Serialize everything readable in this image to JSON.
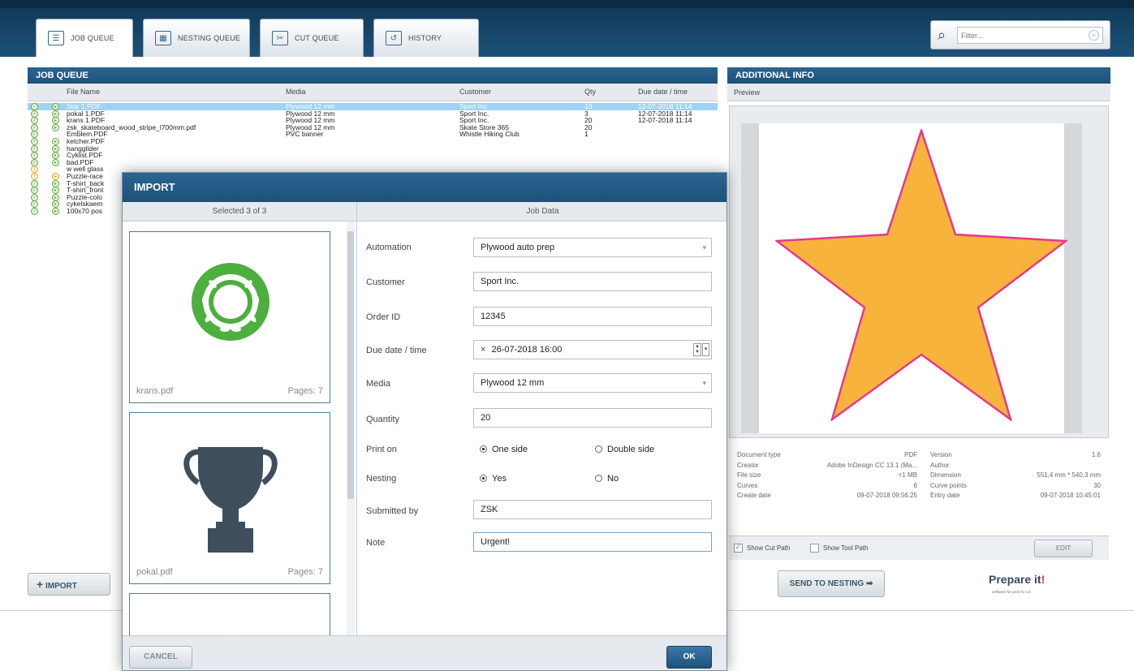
{
  "tabs": [
    {
      "label": "JOB QUEUE",
      "icon": "list-icon",
      "active": true
    },
    {
      "label": "NESTING QUEUE",
      "icon": "nesting-icon",
      "active": false
    },
    {
      "label": "CUT QUEUE",
      "icon": "scissors-icon",
      "active": false
    },
    {
      "label": "HISTORY",
      "icon": "history-icon",
      "active": false
    }
  ],
  "filter": {
    "placeholder": "Filter..."
  },
  "job_queue": {
    "title": "JOB QUEUE",
    "columns": [
      "File Name",
      "Media",
      "Customer",
      "Qty",
      "Due date / time"
    ],
    "rows": [
      {
        "status": "ok",
        "prep": "ok",
        "file": "Star 1.PDF",
        "media": "Plywood 12 mm",
        "customer": "Sport Inc.",
        "qty": "10",
        "due": "12-07-2018 11:14",
        "selected": true
      },
      {
        "status": "ok",
        "prep": "ok",
        "file": "pokal 1.PDF",
        "media": "Plywood 12 mm",
        "customer": "Sport Inc.",
        "qty": "3",
        "due": "12-07-2018 11:14"
      },
      {
        "status": "ok",
        "prep": "ok",
        "file": "krans 1.PDF",
        "media": "Plywood 12 mm",
        "customer": "Sport Inc.",
        "qty": "20",
        "due": "12-07-2018 11:14"
      },
      {
        "status": "ok",
        "prep": "ok",
        "file": "zsk_skateboard_wood_stripe_l700mm.pdf",
        "media": "Plywood 12 mm",
        "customer": "Skate Store 365",
        "qty": "20",
        "due": ""
      },
      {
        "status": "ok",
        "prep": "",
        "file": "Emblem.PDF",
        "media": "PVC banner",
        "customer": "Whistle Hiking Club",
        "qty": "1",
        "due": ""
      },
      {
        "status": "ok",
        "prep": "ok",
        "file": "ketcher.PDF",
        "media": "",
        "customer": "",
        "qty": "",
        "due": ""
      },
      {
        "status": "ok",
        "prep": "ok",
        "file": "hangglider",
        "media": "",
        "customer": "",
        "qty": "",
        "due": ""
      },
      {
        "status": "ok",
        "prep": "ok",
        "file": "Cyklist.PDF",
        "media": "",
        "customer": "",
        "qty": "",
        "due": ""
      },
      {
        "status": "ok",
        "prep": "ok",
        "file": "bad.PDF",
        "media": "",
        "customer": "",
        "qty": "",
        "due": ""
      },
      {
        "status": "warn",
        "prep": "",
        "file": "w well glass",
        "media": "",
        "customer": "",
        "qty": "",
        "due": ""
      },
      {
        "status": "warn",
        "prep": "warn",
        "file": "Puzzle-race",
        "media": "",
        "customer": "",
        "qty": "",
        "due": ""
      },
      {
        "status": "ok",
        "prep": "ok",
        "file": "T-shirt_back",
        "media": "",
        "customer": "",
        "qty": "",
        "due": ""
      },
      {
        "status": "ok",
        "prep": "ok",
        "file": "T-shirt_front",
        "media": "",
        "customer": "",
        "qty": "",
        "due": ""
      },
      {
        "status": "ok",
        "prep": "ok",
        "file": "Puzzle-colo",
        "media": "",
        "customer": "",
        "qty": "",
        "due": ""
      },
      {
        "status": "ok",
        "prep": "ok",
        "file": "cykelskaem",
        "media": "",
        "customer": "",
        "qty": "",
        "due": ""
      },
      {
        "status": "ok",
        "prep": "ok",
        "file": "100x70 pos",
        "media": "",
        "customer": "",
        "qty": "",
        "due": ""
      }
    ],
    "import_label": "IMPORT"
  },
  "additional_info": {
    "title": "ADDITIONAL INFO",
    "preview_label": "Preview",
    "meta_left": [
      {
        "k": "Document type",
        "v": "PDF"
      },
      {
        "k": "Creator",
        "v": "Adobe InDesign CC 13.1 (Ma..."
      },
      {
        "k": "File size",
        "v": "<1 MB"
      },
      {
        "k": "Curves",
        "v": "6"
      },
      {
        "k": "Create date",
        "v": "09-07-2018 09:56:25"
      }
    ],
    "meta_right": [
      {
        "k": "Version",
        "v": "1.6"
      },
      {
        "k": "Author",
        "v": ""
      },
      {
        "k": "Dimension",
        "v": "551,4 mm * 540,3 mm"
      },
      {
        "k": "Curve points",
        "v": "30"
      },
      {
        "k": "Entry date",
        "v": "09-07-2018 10:45:01"
      }
    ],
    "show_cut_path": "Show Cut Path",
    "show_tool_path": "Show Tool Path",
    "edit_label": "EDIT",
    "send_label": "SEND TO NESTING",
    "logo_text": "Prepare it",
    "logo_tagline": "software for print to cut",
    "colors": {
      "star_fill": "#f7b33c",
      "star_stroke": "#e6398b"
    }
  },
  "import_dialog": {
    "title": "IMPORT",
    "selected_label": "Selected 3 of 3",
    "job_data_label": "Job Data",
    "thumbnails": [
      {
        "name": "krans.pdf",
        "pages": "Pages: 7",
        "icon": "laurel-wreath-icon",
        "color": "#4caf3e"
      },
      {
        "name": "pokal.pdf",
        "pages": "Pages: 7",
        "icon": "trophy-icon",
        "color": "#3e4e5c"
      },
      {
        "name": "",
        "pages": "",
        "icon": "star-icon",
        "color": "#f7b33c"
      }
    ],
    "fields": {
      "automation_label": "Automation",
      "automation": "Plywood auto prep",
      "customer_label": "Customer",
      "customer": "Sport Inc.",
      "order_label": "Order ID",
      "order": "12345",
      "due_label": "Due date / time",
      "due": "26-07-2018 16:00",
      "media_label": "Media",
      "media": "Plywood 12 mm",
      "quantity_label": "Quantity",
      "quantity": "20",
      "print_on_label": "Print on",
      "print_one": "One side",
      "print_double": "Double side",
      "nesting_label": "Nesting",
      "nesting_yes": "Yes",
      "nesting_no": "No",
      "submitted_label": "Submitted by",
      "submitted": "ZSK",
      "note_label": "Note",
      "note": "Urgent!"
    },
    "cancel_label": "CANCEL",
    "ok_label": "OK"
  }
}
